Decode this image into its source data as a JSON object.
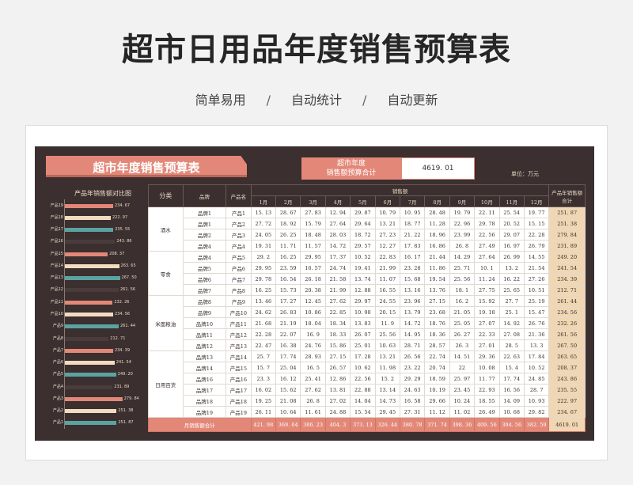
{
  "page": {
    "title": "超市日用品年度销售预算表",
    "subtitle": [
      "简单易用",
      "自动统计",
      "自动更新"
    ],
    "subtitle_sep": "/"
  },
  "sheet": {
    "banner": "超市年度销售预算表",
    "budget_label_1": "超市年度",
    "budget_label_2": "销售额预算合计",
    "budget_value": "4619. 01",
    "unit": "单位：万元",
    "chart_title": "产品年销售额对比图"
  },
  "table": {
    "headers": {
      "category": "分类",
      "brand": "品牌",
      "product": "产品名",
      "sales": "销售额",
      "total_line1": "产品年销售额",
      "total_line2": "合计"
    },
    "months": [
      "1月",
      "2月",
      "3月",
      "4月",
      "5月",
      "6月",
      "7月",
      "8月",
      "9月",
      "10月",
      "11月",
      "12月"
    ],
    "rows": [
      {
        "cat": "酒水",
        "brand": "品牌1",
        "product": "产品1",
        "vals": [
          "15. 13",
          "28. 67",
          "27. 83",
          "12. 94",
          "29. 87",
          "10. 79",
          "10. 95",
          "28. 48",
          "19. 79",
          "22. 11",
          "25. 54",
          "19. 77"
        ],
        "total": "251. 87"
      },
      {
        "cat": "",
        "brand": "品牌1",
        "product": "产品2",
        "vals": [
          "27. 72",
          "18. 92",
          "15. 79",
          "27. 64",
          "29. 64",
          "13. 21",
          "18. 77",
          "11. 28",
          "22. 96",
          "29. 78",
          "20. 52",
          "15. 15"
        ],
        "total": "251. 38"
      },
      {
        "cat": "",
        "brand": "品牌2",
        "product": "产品3",
        "vals": [
          "24. 05",
          "26. 25",
          "18. 48",
          "28. 03",
          "18. 72",
          "27. 23",
          "21. 22",
          "18. 96",
          "23. 99",
          "22. 56",
          "29. 07",
          "22. 28"
        ],
        "total": "279. 84"
      },
      {
        "cat": "",
        "brand": "品牌4",
        "product": "产品4",
        "vals": [
          "19. 31",
          "11. 71",
          "11. 57",
          "14. 72",
          "29. 57",
          "12. 27",
          "17. 83",
          "16. 86",
          "26. 8",
          "27. 49",
          "16. 97",
          "26. 79"
        ],
        "total": "231. 89"
      },
      {
        "cat": "零食",
        "brand": "品牌4",
        "product": "产品5",
        "vals": [
          "29. 2",
          "16. 25",
          "29. 95",
          "17. 37",
          "10. 52",
          "22. 83",
          "16. 17",
          "21. 44",
          "14. 29",
          "27. 64",
          "26. 99",
          "14. 55"
        ],
        "total": "249. 20"
      },
      {
        "cat": "",
        "brand": "品牌5",
        "product": "产品6",
        "vals": [
          "29. 95",
          "23. 59",
          "16. 57",
          "24. 74",
          "19. 41",
          "21. 99",
          "23. 28",
          "11. 86",
          "25. 71",
          "10. 1",
          "13. 2",
          "21. 54"
        ],
        "total": "241. 54"
      },
      {
        "cat": "",
        "brand": "品牌6",
        "product": "产品7",
        "vals": [
          "29. 78",
          "16. 54",
          "26. 18",
          "21. 58",
          "13. 74",
          "11. 07",
          "15. 68",
          "19. 54",
          "25. 56",
          "11. 24",
          "16. 22",
          "27. 26"
        ],
        "total": "234. 39"
      },
      {
        "cat": "",
        "brand": "品牌7",
        "product": "产品8",
        "vals": [
          "16. 25",
          "15. 73",
          "20. 38",
          "21. 99",
          "12. 88",
          "16. 55",
          "13. 16",
          "13. 76",
          "18. 1",
          "27. 75",
          "25. 65",
          "10. 51"
        ],
        "total": "212. 71"
      },
      {
        "cat": "米面粮油",
        "brand": "品牌8",
        "product": "产品9",
        "vals": [
          "13. 46",
          "17. 27",
          "12. 45",
          "27. 62",
          "29. 97",
          "24. 55",
          "23. 96",
          "27. 15",
          "16. 2",
          "15. 92",
          "27. 7",
          "25. 19"
        ],
        "total": "261. 44"
      },
      {
        "cat": "",
        "brand": "品牌9",
        "product": "产品10",
        "vals": [
          "24. 62",
          "26. 83",
          "10. 86",
          "22. 85",
          "10. 98",
          "20. 15",
          "13. 79",
          "23. 68",
          "21. 05",
          "19. 18",
          "25. 1",
          "15. 47"
        ],
        "total": "234. 56"
      },
      {
        "cat": "",
        "brand": "品牌10",
        "product": "产品11",
        "vals": [
          "21. 68",
          "21. 19",
          "18. 04",
          "18. 34",
          "13. 83",
          "11. 9",
          "14. 72",
          "18. 76",
          "25. 05",
          "27. 07",
          "14. 92",
          "26. 76"
        ],
        "total": "232. 26"
      },
      {
        "cat": "",
        "brand": "品牌11",
        "product": "产品12",
        "vals": [
          "22. 28",
          "22. 07",
          "16. 9",
          "18. 33",
          "26. 07",
          "25. 56",
          "14. 95",
          "18. 36",
          "26. 27",
          "22. 33",
          "27. 08",
          "21. 36"
        ],
        "total": "261. 56"
      },
      {
        "cat": "",
        "brand": "品牌12",
        "product": "产品13",
        "vals": [
          "22. 47",
          "16. 38",
          "24. 76",
          "15. 86",
          "25. 01",
          "10. 63",
          "28. 71",
          "28. 57",
          "26. 3",
          "27. 01",
          "28. 5",
          "13. 3"
        ],
        "total": "267. 50"
      },
      {
        "cat": "日用百货",
        "brand": "品牌13",
        "product": "产品14",
        "vals": [
          "25. 7",
          "17. 74",
          "28. 93",
          "27. 15",
          "17. 28",
          "13. 21",
          "26. 56",
          "22. 74",
          "14. 51",
          "29. 36",
          "22. 63",
          "17. 84"
        ],
        "total": "263. 65"
      },
      {
        "cat": "",
        "brand": "品牌14",
        "product": "产品15",
        "vals": [
          "15. 7",
          "25. 04",
          "16. 5",
          "26. 57",
          "10. 62",
          "11. 98",
          "23. 22",
          "20. 74",
          "22",
          "10. 08",
          "15. 4",
          "10. 52"
        ],
        "total": "208. 37"
      },
      {
        "cat": "",
        "brand": "品牌16",
        "product": "产品16",
        "vals": [
          "23. 3",
          "16. 12",
          "25. 41",
          "12. 86",
          "22. 56",
          "15. 2",
          "29. 29",
          "18. 59",
          "25. 97",
          "11. 77",
          "17. 74",
          "24. 85"
        ],
        "total": "243. 86"
      },
      {
        "cat": "",
        "brand": "品牌17",
        "product": "产品17",
        "vals": [
          "16. 02",
          "15. 62",
          "27. 62",
          "13. 81",
          "22. 88",
          "13. 14",
          "24. 63",
          "10. 19",
          "23. 45",
          "22. 93",
          "16. 56",
          "28. 7"
        ],
        "total": "235. 55"
      },
      {
        "cat": "",
        "brand": "品牌18",
        "product": "产品18",
        "vals": [
          "19. 25",
          "21. 08",
          "26. 8",
          "27. 02",
          "14. 04",
          "14. 73",
          "16. 58",
          "29. 66",
          "10. 24",
          "18. 55",
          "14. 09",
          "10. 93"
        ],
        "total": "222. 97"
      },
      {
        "cat": "",
        "brand": "品牌19",
        "product": "产品19",
        "vals": [
          "26. 11",
          "10. 64",
          "11. 61",
          "24. 88",
          "15. 54",
          "29. 45",
          "27. 31",
          "11. 12",
          "11. 02",
          "26. 49",
          "10. 68",
          "29. 82"
        ],
        "total": "234. 67"
      }
    ],
    "footer": {
      "label": "月销售额合计",
      "vals": [
        "421. 98",
        "369. 64",
        "386. 23",
        "404. 3",
        "373. 13",
        "326. 44",
        "380. 78",
        "371. 74",
        "398. 36",
        "409. 56",
        "394. 56",
        "382. 59"
      ],
      "total": "4619. 01"
    }
  },
  "chart_data": {
    "type": "bar",
    "orientation": "horizontal",
    "title": "产品年销售额对比图",
    "categories": [
      "产品19",
      "产品18",
      "产品17",
      "产品16",
      "产品15",
      "产品14",
      "产品13",
      "产品12",
      "产品11",
      "产品10",
      "产品9",
      "产品8",
      "产品7",
      "产品6",
      "产品5",
      "产品4",
      "产品3",
      "产品2",
      "产品1"
    ],
    "values": [
      234.67,
      222.97,
      235.55,
      243.86,
      208.37,
      263.65,
      267.5,
      261.56,
      232.26,
      234.56,
      261.44,
      212.71,
      234.39,
      241.54,
      249.2,
      231.89,
      279.84,
      251.38,
      251.87
    ],
    "value_labels": [
      "234. 67",
      "222. 97",
      "235. 55",
      "243. 86",
      "208. 37",
      "263. 65",
      "267. 50",
      "261. 56",
      "232. 26",
      "234. 56",
      "261. 44",
      "212. 71",
      "234. 39",
      "241. 54",
      "249. 20",
      "231. 89",
      "279. 84",
      "251. 38",
      "251. 87"
    ],
    "colors": [
      "#e38878",
      "#f2dcc0",
      "#5ba3a1",
      "#4a3c3c"
    ],
    "xlim": [
      0,
      300
    ]
  }
}
